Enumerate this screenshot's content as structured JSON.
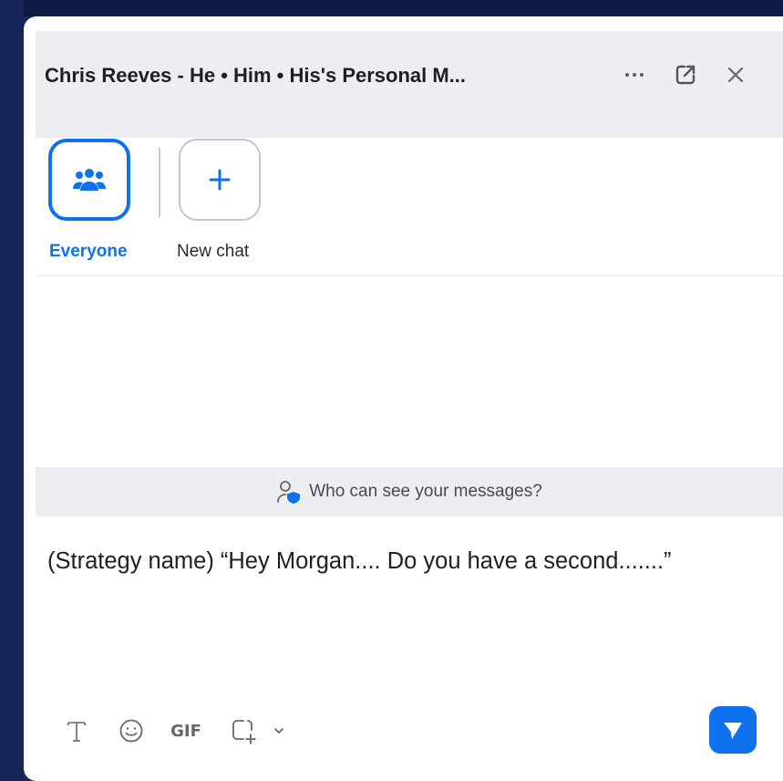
{
  "header": {
    "title": "Chris Reeves - He • Him • His's Personal M...",
    "icons": [
      "more-options-icon",
      "pop-out-icon",
      "close-icon"
    ]
  },
  "chats": [
    {
      "label": "Everyone",
      "icon": "people-group-icon",
      "selected": true
    },
    {
      "label": "New chat",
      "icon": "plus-icon",
      "selected": false
    }
  ],
  "privacy": {
    "text": "Who can see your messages?",
    "icon": "person-shield-icon"
  },
  "composer": {
    "text": "(Strategy name) “Hey Morgan.... Do you have a second.......”",
    "toolbar": {
      "format_icon": "text-format-icon",
      "emoji_icon": "emoji-icon",
      "gif_label": "GIF",
      "screenshot_icon": "screenshot-icon",
      "more_icon": "chevron-down-icon"
    },
    "send_icon": "send-icon"
  },
  "colors": {
    "accent": "#0e72ed",
    "header_bg": "#eceef1",
    "frame": "#1b2a5a"
  }
}
